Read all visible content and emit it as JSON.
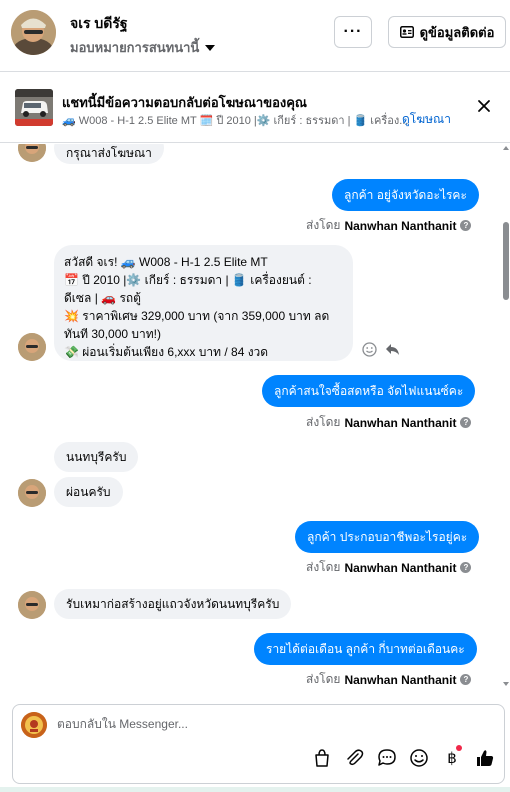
{
  "header": {
    "contact_name": "จเร บดีรัฐ",
    "assign_label": "มอบหมายการสนทนานี้",
    "more_label": "···",
    "contact_info_label": "ดูข้อมูลติดต่อ"
  },
  "ad_banner": {
    "title": "แชทนี้มีข้อความตอบกลับต่อโฆษณาของคุณ",
    "subtitle": "🚙 W008 - H-1 2.5 Elite MT 🗓️ ปี 2010 |⚙️ เกียร์ : ธรรมดา | 🛢️ เครื่อง...",
    "link_label": "ดูโฆษณา"
  },
  "messages": {
    "m0": "กรุณาส่งโฆษณา",
    "m1": "ลูกค้า อยู่จังหวัดอะไรคะ",
    "m2_l1": "สวัสดี จเร! 🚙 W008 - H-1 2.5 Elite MT",
    "m2_l2": "📅 ปี 2010 |⚙️ เกียร์ : ธรรมดา | 🛢️ เครื่องยนต์ :",
    "m2_l3": "ดีเซล | 🚗 รถตู้",
    "m2_l4": "💥 ราคาพิเศษ 329,000 บาท (จาก 359,000 บาท ลด",
    "m2_l5": "ทันที 30,000 บาท!)",
    "m2_l6": "💸 ผ่อนเริ่มต้นเพียง 6,xxx บาท / 84 งวด",
    "m3": "ลูกค้าสนใจซื้อสดหรือ จัดไฟแนนซ์คะ",
    "m4": "นนทบุรีครับ",
    "m5": "ผ่อนครับ",
    "m6": "ลูกค้า ประกอบอาชีพอะไรอยู่คะ",
    "m7": "รับเหมาก่อสร้างอยู่แถวจังหวัดนนทบุรีครับ",
    "m8": "รายได้ต่อเดือน ลูกค้า กี่บาทต่อเดือนคะ"
  },
  "sent_by": {
    "prefix": "ส่งโดย",
    "agent": "Nanwhan Nanthanit"
  },
  "composer": {
    "placeholder": "ตอบกลับใน Messenger..."
  },
  "icons": {
    "currency_glyph": "฿"
  },
  "colors": {
    "outgoing_bubble": "#0084ff",
    "incoming_bubble": "#f0f2f5",
    "link": "#0064d1"
  }
}
